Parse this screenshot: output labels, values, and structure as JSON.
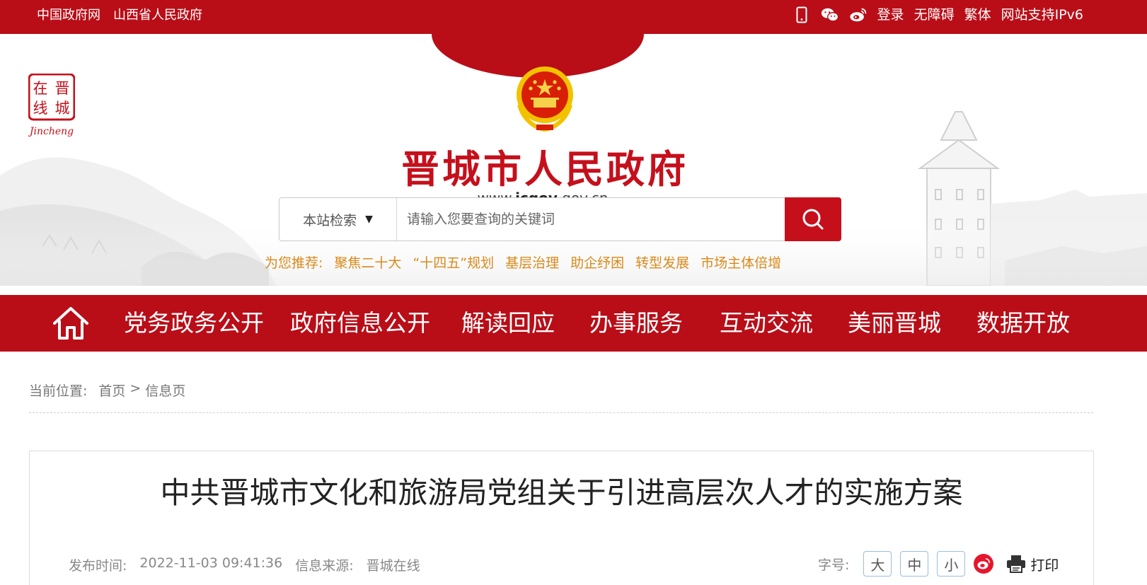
{
  "topbar": {
    "links": [
      "中国政府网",
      "山西省人民政府"
    ],
    "icons": [
      "mobile-icon",
      "wechat-icon",
      "weibo-icon"
    ],
    "right_links": [
      "登录",
      "无障碍",
      "繁体",
      "网站支持IPv6"
    ]
  },
  "header": {
    "logo_text": [
      "在",
      "晋",
      "线",
      "城"
    ],
    "logo_caption": "Jincheng",
    "site_title": "晋城市人民政府",
    "site_url_prefix": "www.",
    "site_url_bold": "jcgov",
    "site_url_suffix": ".gov.cn"
  },
  "search": {
    "scope_label": "本站检索",
    "scope_arrow": "▼",
    "placeholder": "请输入您要查询的关键词",
    "button_icon": "search-icon"
  },
  "recommend": {
    "label": "为您推荐:",
    "items": [
      "聚焦二十大",
      "“十四五”规划",
      "基层治理",
      "助企纾困",
      "转型发展",
      "市场主体倍增"
    ]
  },
  "nav": {
    "home_icon": "home-icon",
    "items": [
      "党务政务公开",
      "政府信息公开",
      "解读回应",
      "办事服务",
      "互动交流",
      "美丽晋城",
      "数据开放"
    ]
  },
  "breadcrumb": {
    "label": "当前位置:",
    "home": "首页",
    "separator": ">",
    "current": "信息页"
  },
  "article": {
    "title": "中共晋城市文化和旅游局党组关于引进高层次人才的实施方案",
    "publish_label": "发布时间:",
    "publish_time": "2022-11-03 09:41:36",
    "source_label": "信息来源:",
    "source": "晋城在线",
    "font_size_label": "字号:",
    "font_sizes": [
      "大",
      "中",
      "小"
    ],
    "share_icon": "weibo-share-icon",
    "print_label": "打印"
  },
  "colors": {
    "brand_red": "#b90e18",
    "title_red": "#c5101c",
    "recommend_orange": "#d98a1c"
  }
}
